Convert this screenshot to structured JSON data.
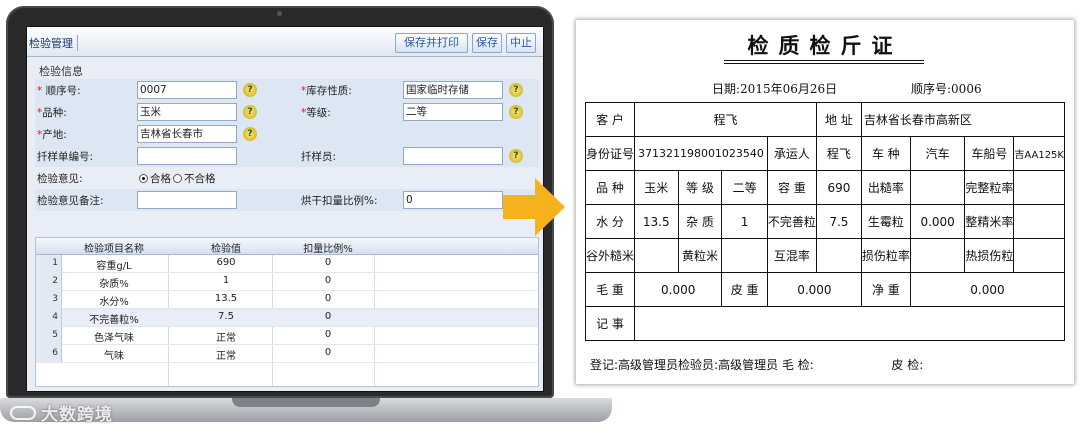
{
  "app": {
    "tab": "检验管理",
    "buttons": {
      "save_print": "保存并打印",
      "save": "保存",
      "stop": "中止"
    },
    "section_title": "检验信息",
    "form": {
      "seq_label": "顺序号:",
      "seq_value": "0007",
      "storage_label": "库存性质:",
      "storage_value": "国家临时存储",
      "variety_label": "品种:",
      "variety_value": "玉米",
      "grade_label": "等级:",
      "grade_value": "二等",
      "origin_label": "产地:",
      "origin_value": "吉林省长春市",
      "sample_no_label": "扦样单编号:",
      "sample_no_value": "",
      "sampler_label": "扦样员:",
      "sampler_value": "",
      "opinion_label": "检验意见:",
      "opinion_pass": "合格",
      "opinion_fail": "不合格",
      "remark_label": "检验意见备注:",
      "remark_value": "",
      "dry_label": "烘干扣量比例%:",
      "dry_value": "0",
      "help_glyph": "?"
    },
    "grid": {
      "headers": [
        "检验项目名称",
        "检验值",
        "扣量比例%"
      ],
      "rows": [
        {
          "num": "1",
          "name": "容重g/L",
          "value": "690",
          "ratio": "0"
        },
        {
          "num": "2",
          "name": "杂质%",
          "value": "1",
          "ratio": "0"
        },
        {
          "num": "3",
          "name": "水分%",
          "value": "13.5",
          "ratio": "0"
        },
        {
          "num": "4",
          "name": "不完善粒%",
          "value": "7.5",
          "ratio": "0"
        },
        {
          "num": "5",
          "name": "色泽气味",
          "value": "正常",
          "ratio": "0"
        },
        {
          "num": "6",
          "name": "气味",
          "value": "正常",
          "ratio": "0"
        }
      ]
    }
  },
  "watermark": "大数跨境",
  "cert": {
    "title": "检质检斤证",
    "date": "日期:2015年06月26日",
    "serial": "顺序号:0006",
    "r1": {
      "kehu": "客 户",
      "kehu_val": "程飞",
      "dizhi": "地 址",
      "dizhi_val": "吉林省长春市高新区"
    },
    "r2": {
      "id": "身份证号",
      "id_val": "371321198001023540",
      "carrier": "承运人",
      "carrier_val": "程飞",
      "cheng": "车 种",
      "cheng_val": "汽车",
      "plate": "车船号",
      "plate_val": "吉AA125K"
    },
    "r3": {
      "pz": "品 种",
      "pz_val": "玉米",
      "dj": "等 级",
      "dj_val": "二等",
      "rz": "容 重",
      "rz_val": "690",
      "cml": "出糙率",
      "wz": "完整粒率"
    },
    "r4": {
      "sf": "水 分",
      "sf_val": "13.5",
      "zz": "杂 质",
      "zz_val": "1",
      "bws": "不完善粒",
      "bws_val": "7.5",
      "sm": "生霉粒",
      "sm_val": "0.000",
      "zj": "整精米率"
    },
    "r5": {
      "gw": "谷外糙米",
      "hl": "黄粒米",
      "hh": "互混率",
      "ss": "损伤粒率",
      "rs": "热损伤粒"
    },
    "r6": {
      "mz": "毛 重",
      "mz_val": "0.000",
      "pz": "皮 重",
      "pz_val": "0.000",
      "jz": "净 重",
      "jz_val": "0.000"
    },
    "r7": {
      "js": "记 事"
    },
    "signature": "登记:高级管理员检验员:高级管理员 毛 检:",
    "skin_check": "皮 检:"
  }
}
